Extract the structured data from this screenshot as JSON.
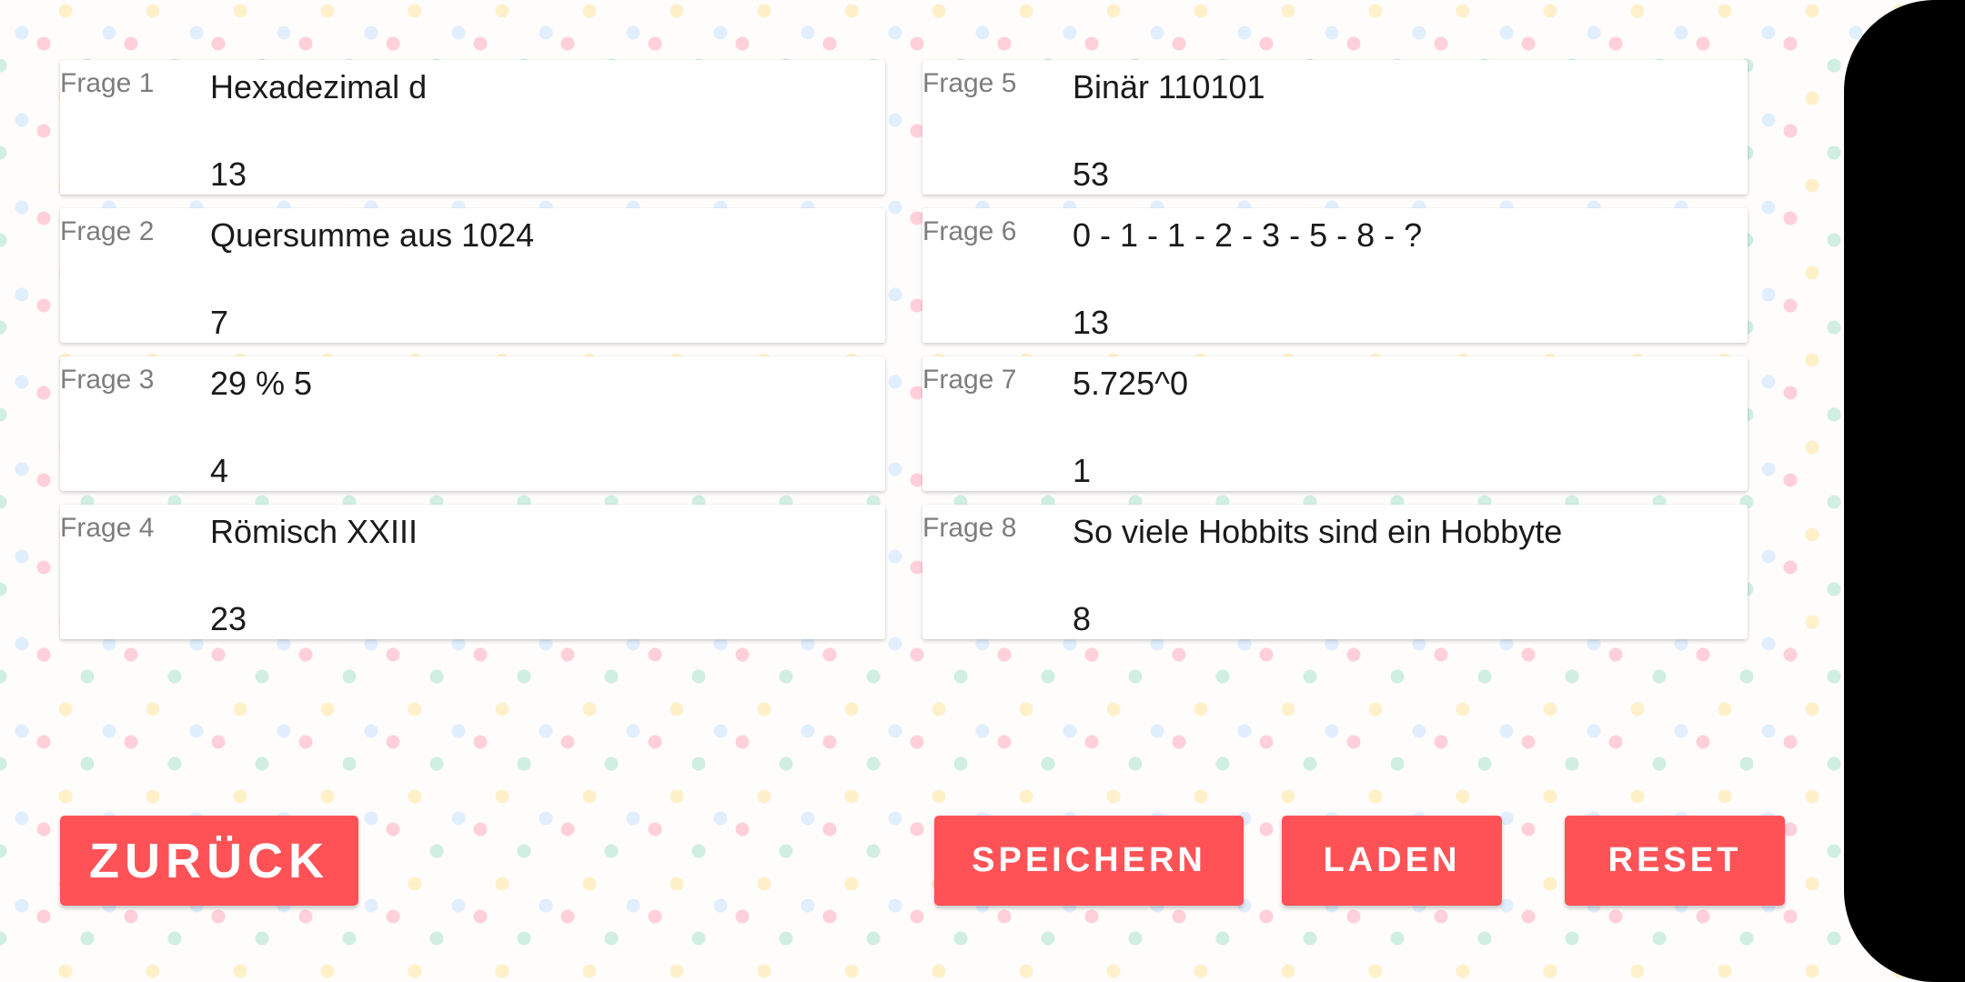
{
  "questions": [
    {
      "label": "Frage 1",
      "question": "Hexadezimal d",
      "answer": "13"
    },
    {
      "label": "Frage 2",
      "question": "Quersumme aus 1024",
      "answer": "7"
    },
    {
      "label": "Frage 3",
      "question": "29 % 5",
      "answer": "4"
    },
    {
      "label": "Frage 4",
      "question": "Römisch XXIII",
      "answer": "23"
    },
    {
      "label": "Frage 5",
      "question": "Binär 110101",
      "answer": "53"
    },
    {
      "label": "Frage 6",
      "question": "0 - 1 - 1 - 2 - 3 - 5 - 8 - ?",
      "answer": "13"
    },
    {
      "label": "Frage 7",
      "question": "5.725^0",
      "answer": "1"
    },
    {
      "label": "Frage 8",
      "question": "So viele Hobbits sind ein Hobbyte",
      "answer": "8"
    }
  ],
  "buttons": {
    "back": "ZURÜCK",
    "save": "SPEICHERN",
    "load": "LADEN",
    "reset": "RESET"
  },
  "colors": {
    "button": "#ff5257",
    "label": "#7d7d7d"
  }
}
